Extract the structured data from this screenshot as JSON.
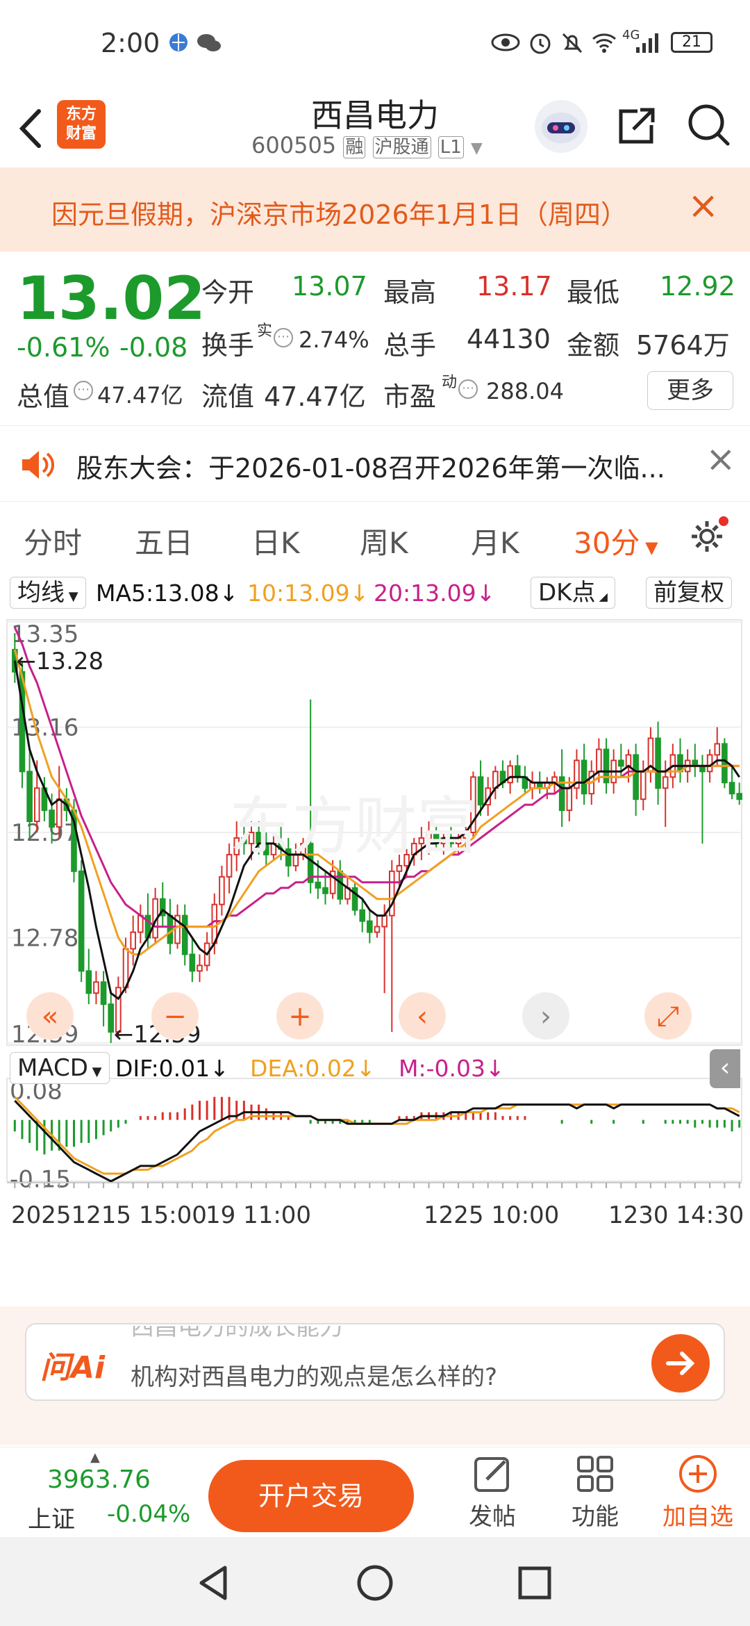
{
  "status_bar": {
    "time": "2:00",
    "network": "4G",
    "battery": "21"
  },
  "header": {
    "back_icon": "chevron-left-icon",
    "logo_text_1": "东方",
    "logo_text_2": "财富",
    "title": "西昌电力",
    "code": "600505",
    "badges": [
      "融",
      "沪股通",
      "L1"
    ],
    "share_icon": "share-icon",
    "search_icon": "search-icon"
  },
  "notice": {
    "text": "因元旦假期，沪深京市场2026年1月1日（周四）",
    "close": "×"
  },
  "quote": {
    "price": "13.02",
    "change_pct": "-0.61%",
    "change": "-0.08",
    "open_label": "今开",
    "open": "13.07",
    "high_label": "最高",
    "high": "13.17",
    "low_label": "最低",
    "low": "12.92",
    "turnover_label": "换手",
    "turnover_sup": "实",
    "turnover": "2.74%",
    "volume_label": "总手",
    "volume": "44130",
    "amount_label": "金额",
    "amount": "5764万",
    "mcap_label": "总值",
    "mcap": "47.47亿",
    "float_label": "流值",
    "float": "47.47亿",
    "pe_label": "市盈",
    "pe_sup": "动",
    "pe": "288.04",
    "more_button": "更多"
  },
  "announcement": {
    "text": "股东大会：于2026-01-08召开2026年第一次临...",
    "close": "×"
  },
  "tabs": {
    "items": [
      "分时",
      "五日",
      "日K",
      "周K",
      "月K",
      "30分"
    ],
    "active": "30分"
  },
  "ma_row": {
    "selector": "均线",
    "ma5": "MA5:13.08",
    "ma10": "10:13.09",
    "ma20": "20:13.09",
    "dk_button": "DK点",
    "adjust_button": "前复权"
  },
  "chart_data": {
    "type": "candlestick",
    "interval": "30分",
    "y_ticks": [
      "13.35",
      "13.16",
      "12.97",
      "12.78",
      "12.59"
    ],
    "ylim": [
      12.59,
      13.35
    ],
    "max_label": "13.28",
    "min_label": "12.59",
    "x_labels": [
      "20251215 15:00",
      "19 11:00",
      "1225 10:00",
      "1230 14:30"
    ],
    "colors": {
      "up": "#d9302b",
      "down": "#1c9a2c",
      "ma5": "#111111",
      "ma10": "#f0a020",
      "ma20": "#c8208a"
    },
    "candles": [
      {
        "o": 13.3,
        "h": 13.33,
        "l": 13.24,
        "c": 13.26
      },
      {
        "o": 13.26,
        "h": 13.28,
        "l": 13.05,
        "c": 13.08
      },
      {
        "o": 13.08,
        "h": 13.12,
        "l": 12.96,
        "c": 12.99
      },
      {
        "o": 12.99,
        "h": 13.1,
        "l": 12.97,
        "c": 13.05
      },
      {
        "o": 13.05,
        "h": 13.07,
        "l": 12.99,
        "c": 13.01
      },
      {
        "o": 13.01,
        "h": 13.04,
        "l": 12.95,
        "c": 12.98
      },
      {
        "o": 12.98,
        "h": 13.09,
        "l": 12.96,
        "c": 13.03
      },
      {
        "o": 13.03,
        "h": 13.05,
        "l": 12.99,
        "c": 13.01
      },
      {
        "o": 13.01,
        "h": 13.03,
        "l": 12.88,
        "c": 12.9
      },
      {
        "o": 12.9,
        "h": 12.92,
        "l": 12.7,
        "c": 12.72
      },
      {
        "o": 12.72,
        "h": 12.76,
        "l": 12.66,
        "c": 12.68
      },
      {
        "o": 12.68,
        "h": 12.72,
        "l": 12.66,
        "c": 12.7
      },
      {
        "o": 12.7,
        "h": 12.72,
        "l": 12.62,
        "c": 12.66
      },
      {
        "o": 12.66,
        "h": 12.68,
        "l": 12.59,
        "c": 12.61
      },
      {
        "o": 12.61,
        "h": 12.71,
        "l": 12.6,
        "c": 12.69
      },
      {
        "o": 12.69,
        "h": 12.78,
        "l": 12.68,
        "c": 12.76
      },
      {
        "o": 12.76,
        "h": 12.82,
        "l": 12.73,
        "c": 12.79
      },
      {
        "o": 12.79,
        "h": 12.84,
        "l": 12.77,
        "c": 12.82
      },
      {
        "o": 12.82,
        "h": 12.86,
        "l": 12.76,
        "c": 12.78
      },
      {
        "o": 12.78,
        "h": 12.87,
        "l": 12.77,
        "c": 12.85
      },
      {
        "o": 12.85,
        "h": 12.88,
        "l": 12.8,
        "c": 12.82
      },
      {
        "o": 12.82,
        "h": 12.85,
        "l": 12.75,
        "c": 12.77
      },
      {
        "o": 12.77,
        "h": 12.84,
        "l": 12.76,
        "c": 12.82
      },
      {
        "o": 12.82,
        "h": 12.84,
        "l": 12.73,
        "c": 12.75
      },
      {
        "o": 12.75,
        "h": 12.78,
        "l": 12.7,
        "c": 12.72
      },
      {
        "o": 12.72,
        "h": 12.75,
        "l": 12.7,
        "c": 12.73
      },
      {
        "o": 12.73,
        "h": 12.79,
        "l": 12.72,
        "c": 12.77
      },
      {
        "o": 12.77,
        "h": 12.86,
        "l": 12.75,
        "c": 12.84
      },
      {
        "o": 12.84,
        "h": 12.91,
        "l": 12.82,
        "c": 12.89
      },
      {
        "o": 12.89,
        "h": 12.95,
        "l": 12.86,
        "c": 12.93
      },
      {
        "o": 12.93,
        "h": 12.99,
        "l": 12.9,
        "c": 12.96
      },
      {
        "o": 12.96,
        "h": 12.98,
        "l": 12.93,
        "c": 12.95
      },
      {
        "o": 12.95,
        "h": 12.99,
        "l": 12.92,
        "c": 12.97
      },
      {
        "o": 12.97,
        "h": 12.99,
        "l": 12.93,
        "c": 12.95
      },
      {
        "o": 12.95,
        "h": 12.97,
        "l": 12.91,
        "c": 12.93
      },
      {
        "o": 12.93,
        "h": 12.97,
        "l": 12.92,
        "c": 12.95
      },
      {
        "o": 12.95,
        "h": 12.98,
        "l": 12.92,
        "c": 12.94
      },
      {
        "o": 12.94,
        "h": 12.96,
        "l": 12.89,
        "c": 12.91
      },
      {
        "o": 12.91,
        "h": 12.95,
        "l": 12.9,
        "c": 12.93
      },
      {
        "o": 12.93,
        "h": 12.96,
        "l": 12.92,
        "c": 12.95
      },
      {
        "o": 12.95,
        "h": 13.21,
        "l": 12.86,
        "c": 12.88
      },
      {
        "o": 12.88,
        "h": 12.92,
        "l": 12.85,
        "c": 12.87
      },
      {
        "o": 12.87,
        "h": 12.9,
        "l": 12.84,
        "c": 12.86
      },
      {
        "o": 12.86,
        "h": 12.92,
        "l": 12.85,
        "c": 12.9
      },
      {
        "o": 12.9,
        "h": 12.92,
        "l": 12.84,
        "c": 12.85
      },
      {
        "o": 12.85,
        "h": 12.89,
        "l": 12.84,
        "c": 12.87
      },
      {
        "o": 12.87,
        "h": 12.88,
        "l": 12.82,
        "c": 12.83
      },
      {
        "o": 12.83,
        "h": 12.85,
        "l": 12.79,
        "c": 12.81
      },
      {
        "o": 12.81,
        "h": 12.83,
        "l": 12.77,
        "c": 12.79
      },
      {
        "o": 12.79,
        "h": 12.82,
        "l": 12.78,
        "c": 12.8
      },
      {
        "o": 12.8,
        "h": 12.84,
        "l": 12.68,
        "c": 12.82
      },
      {
        "o": 12.82,
        "h": 12.92,
        "l": 12.61,
        "c": 12.9
      },
      {
        "o": 12.9,
        "h": 12.93,
        "l": 12.87,
        "c": 12.91
      },
      {
        "o": 12.91,
        "h": 12.94,
        "l": 12.89,
        "c": 12.93
      },
      {
        "o": 12.93,
        "h": 12.96,
        "l": 12.91,
        "c": 12.95
      },
      {
        "o": 12.95,
        "h": 12.98,
        "l": 12.92,
        "c": 12.96
      },
      {
        "o": 12.96,
        "h": 12.99,
        "l": 12.93,
        "c": 12.97
      },
      {
        "o": 12.97,
        "h": 12.98,
        "l": 12.94,
        "c": 12.95
      },
      {
        "o": 12.95,
        "h": 12.97,
        "l": 12.93,
        "c": 12.96
      },
      {
        "o": 12.96,
        "h": 12.98,
        "l": 12.94,
        "c": 12.95
      },
      {
        "o": 12.95,
        "h": 12.97,
        "l": 12.93,
        "c": 12.96
      },
      {
        "o": 12.96,
        "h": 12.98,
        "l": 12.94,
        "c": 12.97
      },
      {
        "o": 12.97,
        "h": 13.08,
        "l": 12.96,
        "c": 13.07
      },
      {
        "o": 13.07,
        "h": 13.1,
        "l": 13.0,
        "c": 13.02
      },
      {
        "o": 13.02,
        "h": 13.07,
        "l": 13.0,
        "c": 13.05
      },
      {
        "o": 13.05,
        "h": 13.09,
        "l": 13.03,
        "c": 13.08
      },
      {
        "o": 13.08,
        "h": 13.1,
        "l": 13.05,
        "c": 13.06
      },
      {
        "o": 13.06,
        "h": 13.1,
        "l": 13.04,
        "c": 13.09
      },
      {
        "o": 13.09,
        "h": 13.11,
        "l": 13.06,
        "c": 13.07
      },
      {
        "o": 13.07,
        "h": 13.09,
        "l": 13.04,
        "c": 13.05
      },
      {
        "o": 13.05,
        "h": 13.08,
        "l": 13.03,
        "c": 13.06
      },
      {
        "o": 13.06,
        "h": 13.08,
        "l": 13.04,
        "c": 13.05
      },
      {
        "o": 13.05,
        "h": 13.07,
        "l": 13.03,
        "c": 13.06
      },
      {
        "o": 13.06,
        "h": 13.08,
        "l": 13.04,
        "c": 13.07
      },
      {
        "o": 13.07,
        "h": 13.12,
        "l": 12.98,
        "c": 13.01
      },
      {
        "o": 13.01,
        "h": 13.07,
        "l": 12.99,
        "c": 13.05
      },
      {
        "o": 13.05,
        "h": 13.12,
        "l": 13.03,
        "c": 13.1
      },
      {
        "o": 13.1,
        "h": 13.13,
        "l": 13.02,
        "c": 13.04
      },
      {
        "o": 13.04,
        "h": 13.1,
        "l": 13.02,
        "c": 13.08
      },
      {
        "o": 13.08,
        "h": 13.14,
        "l": 13.06,
        "c": 13.12
      },
      {
        "o": 13.12,
        "h": 13.14,
        "l": 13.04,
        "c": 13.06
      },
      {
        "o": 13.06,
        "h": 13.12,
        "l": 13.04,
        "c": 13.1
      },
      {
        "o": 13.1,
        "h": 13.13,
        "l": 13.07,
        "c": 13.09
      },
      {
        "o": 13.09,
        "h": 13.12,
        "l": 13.06,
        "c": 13.11
      },
      {
        "o": 13.11,
        "h": 13.13,
        "l": 13.0,
        "c": 13.03
      },
      {
        "o": 13.03,
        "h": 13.1,
        "l": 13.01,
        "c": 13.08
      },
      {
        "o": 13.08,
        "h": 13.16,
        "l": 13.06,
        "c": 13.14
      },
      {
        "o": 13.14,
        "h": 13.17,
        "l": 13.02,
        "c": 13.05
      },
      {
        "o": 13.05,
        "h": 13.1,
        "l": 12.98,
        "c": 13.07
      },
      {
        "o": 13.07,
        "h": 13.13,
        "l": 13.05,
        "c": 13.11
      },
      {
        "o": 13.11,
        "h": 13.14,
        "l": 13.06,
        "c": 13.08
      },
      {
        "o": 13.08,
        "h": 13.12,
        "l": 13.06,
        "c": 13.1
      },
      {
        "o": 13.1,
        "h": 13.13,
        "l": 13.07,
        "c": 13.09
      },
      {
        "o": 13.09,
        "h": 13.11,
        "l": 12.95,
        "c": 13.08
      },
      {
        "o": 13.08,
        "h": 13.12,
        "l": 13.06,
        "c": 13.11
      },
      {
        "o": 13.11,
        "h": 13.16,
        "l": 13.09,
        "c": 13.13
      },
      {
        "o": 13.13,
        "h": 13.14,
        "l": 13.05,
        "c": 13.06
      },
      {
        "o": 13.06,
        "h": 13.09,
        "l": 13.03,
        "c": 13.04
      },
      {
        "o": 13.04,
        "h": 13.06,
        "l": 13.02,
        "c": 13.03
      }
    ],
    "ma5": [
      13.28,
      13.2,
      13.12,
      13.08,
      13.05,
      13.02,
      13.03,
      13.02,
      12.99,
      12.93,
      12.87,
      12.8,
      12.74,
      12.68,
      12.67,
      12.69,
      12.72,
      12.76,
      12.78,
      12.81,
      12.83,
      12.82,
      12.81,
      12.8,
      12.78,
      12.76,
      12.75,
      12.77,
      12.8,
      12.83,
      12.87,
      12.91,
      12.93,
      12.95,
      12.95,
      12.95,
      12.94,
      12.93,
      12.93,
      12.93,
      12.92,
      12.91,
      12.9,
      12.89,
      12.88,
      12.87,
      12.86,
      12.85,
      12.83,
      12.82,
      12.82,
      12.84,
      12.87,
      12.9,
      12.93,
      12.94,
      12.95,
      12.95,
      12.96,
      12.96,
      12.96,
      12.97,
      12.99,
      13.01,
      13.03,
      13.05,
      13.06,
      13.07,
      13.07,
      13.07,
      13.06,
      13.06,
      13.06,
      13.06,
      13.05,
      13.05,
      13.06,
      13.06,
      13.07,
      13.08,
      13.08,
      13.08,
      13.08,
      13.09,
      13.08,
      13.08,
      13.09,
      13.08,
      13.08,
      13.09,
      13.09,
      13.09,
      13.09,
      13.09,
      13.09,
      13.1,
      13.1,
      13.09,
      13.07
    ],
    "ma10": [
      13.3,
      13.25,
      13.2,
      13.15,
      13.11,
      13.07,
      13.05,
      13.03,
      13.01,
      12.98,
      12.94,
      12.9,
      12.86,
      12.82,
      12.78,
      12.76,
      12.75,
      12.75,
      12.76,
      12.77,
      12.78,
      12.79,
      12.8,
      12.8,
      12.8,
      12.8,
      12.8,
      12.8,
      12.81,
      12.82,
      12.84,
      12.86,
      12.88,
      12.9,
      12.91,
      12.92,
      12.93,
      12.93,
      12.93,
      12.93,
      12.93,
      12.93,
      12.92,
      12.91,
      12.9,
      12.89,
      12.88,
      12.87,
      12.86,
      12.85,
      12.85,
      12.85,
      12.86,
      12.87,
      12.88,
      12.89,
      12.9,
      12.91,
      12.92,
      12.93,
      12.94,
      12.95,
      12.96,
      12.98,
      12.99,
      13.0,
      13.01,
      13.02,
      13.03,
      13.04,
      13.05,
      13.05,
      13.05,
      13.06,
      13.06,
      13.06,
      13.06,
      13.06,
      13.06,
      13.07,
      13.07,
      13.07,
      13.07,
      13.07,
      13.08,
      13.08,
      13.08,
      13.08,
      13.08,
      13.08,
      13.08,
      13.09,
      13.09,
      13.09,
      13.09,
      13.09,
      13.09,
      13.09,
      13.09
    ],
    "ma20": [
      13.34,
      13.31,
      13.27,
      13.24,
      13.2,
      13.16,
      13.12,
      13.08,
      13.04,
      13.0,
      12.97,
      12.94,
      12.91,
      12.88,
      12.86,
      12.84,
      12.83,
      12.82,
      12.81,
      12.8,
      12.8,
      12.8,
      12.8,
      12.8,
      12.8,
      12.8,
      12.8,
      12.81,
      12.81,
      12.82,
      12.82,
      12.83,
      12.84,
      12.85,
      12.86,
      12.86,
      12.87,
      12.87,
      12.88,
      12.88,
      12.89,
      12.89,
      12.89,
      12.89,
      12.89,
      12.89,
      12.89,
      12.88,
      12.88,
      12.88,
      12.88,
      12.88,
      12.88,
      12.89,
      12.89,
      12.9,
      12.9,
      12.91,
      12.92,
      12.93,
      12.93,
      12.94,
      12.95,
      12.96,
      12.97,
      12.98,
      12.99,
      13.0,
      13.01,
      13.02,
      13.02,
      13.03,
      13.04,
      13.04,
      13.05,
      13.05,
      13.06,
      13.06,
      13.06,
      13.07,
      13.07,
      13.07,
      13.07,
      13.08,
      13.08,
      13.08,
      13.08,
      13.08,
      13.08,
      13.09,
      13.09,
      13.09,
      13.09,
      13.09,
      13.09,
      13.09,
      13.09,
      13.09,
      13.09
    ]
  },
  "macd": {
    "selector": "MACD",
    "dif": "DIF:0.01",
    "dea": "DEA:0.02",
    "m": "M:-0.03",
    "y_ticks": [
      "0.08",
      "-0.15"
    ],
    "ylim": [
      -0.16,
      0.09
    ],
    "dif_values": [
      0.05,
      0.03,
      0.01,
      -0.01,
      -0.03,
      -0.05,
      -0.07,
      -0.09,
      -0.11,
      -0.12,
      -0.13,
      -0.14,
      -0.15,
      -0.16,
      -0.15,
      -0.14,
      -0.13,
      -0.12,
      -0.12,
      -0.12,
      -0.11,
      -0.1,
      -0.09,
      -0.07,
      -0.05,
      -0.03,
      -0.02,
      -0.01,
      0.0,
      0.01,
      0.01,
      0.02,
      0.02,
      0.02,
      0.02,
      0.02,
      0.02,
      0.02,
      0.01,
      0.01,
      0.01,
      0.0,
      0.0,
      0.0,
      0.0,
      -0.01,
      -0.01,
      -0.01,
      -0.01,
      -0.01,
      -0.01,
      -0.01,
      0.0,
      0.0,
      0.0,
      0.01,
      0.01,
      0.01,
      0.01,
      0.02,
      0.02,
      0.02,
      0.03,
      0.03,
      0.03,
      0.03,
      0.04,
      0.04,
      0.04,
      0.04,
      0.04,
      0.04,
      0.04,
      0.04,
      0.04,
      0.04,
      0.03,
      0.04,
      0.04,
      0.04,
      0.04,
      0.03,
      0.04,
      0.04,
      0.04,
      0.04,
      0.04,
      0.04,
      0.04,
      0.04,
      0.04,
      0.04,
      0.04,
      0.04,
      0.04,
      0.03,
      0.03,
      0.02,
      0.01
    ],
    "dea_values": [
      0.06,
      0.04,
      0.02,
      0.0,
      -0.02,
      -0.04,
      -0.06,
      -0.08,
      -0.1,
      -0.11,
      -0.12,
      -0.13,
      -0.14,
      -0.14,
      -0.14,
      -0.14,
      -0.13,
      -0.13,
      -0.13,
      -0.12,
      -0.12,
      -0.11,
      -0.1,
      -0.09,
      -0.08,
      -0.06,
      -0.05,
      -0.03,
      -0.02,
      -0.01,
      0.0,
      0.0,
      0.01,
      0.01,
      0.01,
      0.01,
      0.01,
      0.01,
      0.01,
      0.01,
      0.01,
      0.0,
      0.0,
      0.0,
      0.0,
      0.0,
      -0.01,
      -0.01,
      -0.01,
      -0.01,
      -0.01,
      -0.01,
      -0.01,
      -0.01,
      0.0,
      0.0,
      0.0,
      0.0,
      0.01,
      0.01,
      0.01,
      0.02,
      0.02,
      0.02,
      0.03,
      0.03,
      0.03,
      0.03,
      0.04,
      0.04,
      0.04,
      0.04,
      0.04,
      0.04,
      0.04,
      0.04,
      0.04,
      0.04,
      0.04,
      0.04,
      0.04,
      0.04,
      0.04,
      0.04,
      0.04,
      0.04,
      0.04,
      0.04,
      0.04,
      0.04,
      0.04,
      0.04,
      0.04,
      0.04,
      0.04,
      0.03,
      0.03,
      0.03,
      0.02
    ],
    "hist": [
      -0.03,
      -0.05,
      -0.06,
      -0.08,
      -0.09,
      -0.08,
      -0.08,
      -0.07,
      -0.07,
      -0.06,
      -0.06,
      -0.05,
      -0.04,
      -0.03,
      -0.02,
      -0.01,
      0.0,
      0.01,
      0.01,
      0.01,
      0.02,
      0.02,
      0.02,
      0.03,
      0.04,
      0.05,
      0.05,
      0.06,
      0.06,
      0.06,
      0.05,
      0.05,
      0.04,
      0.04,
      0.03,
      0.02,
      0.02,
      0.01,
      0.0,
      0.0,
      -0.01,
      -0.01,
      -0.01,
      -0.01,
      -0.01,
      -0.01,
      -0.01,
      -0.01,
      -0.01,
      0.0,
      0.0,
      0.0,
      0.01,
      0.01,
      0.01,
      0.02,
      0.02,
      0.02,
      0.02,
      0.02,
      0.02,
      0.02,
      0.02,
      0.02,
      0.02,
      0.02,
      0.01,
      0.01,
      0.01,
      0.01,
      0.0,
      0.0,
      0.0,
      0.0,
      -0.01,
      0.0,
      0.0,
      0.0,
      -0.01,
      0.0,
      0.0,
      -0.01,
      0.0,
      0.0,
      0.0,
      -0.01,
      0.0,
      0.0,
      -0.01,
      -0.01,
      -0.01,
      -0.01,
      -0.02,
      -0.01,
      -0.02,
      -0.02,
      -0.02,
      -0.03,
      -0.02
    ]
  },
  "chart_controls": [
    "«",
    "−",
    "+",
    "‹",
    "›",
    "⤢"
  ],
  "ai_box": {
    "logo": "问Ai",
    "question_faded": "西昌电力的成长能力",
    "question": "机构对西昌电力的观点是怎么样的?"
  },
  "bottom_bar": {
    "index_value": "3963.76",
    "index_name": "上证",
    "index_change": "-0.04%",
    "trade_button": "开户交易",
    "post_label": "发帖",
    "func_label": "功能",
    "watch_label": "加自选"
  }
}
